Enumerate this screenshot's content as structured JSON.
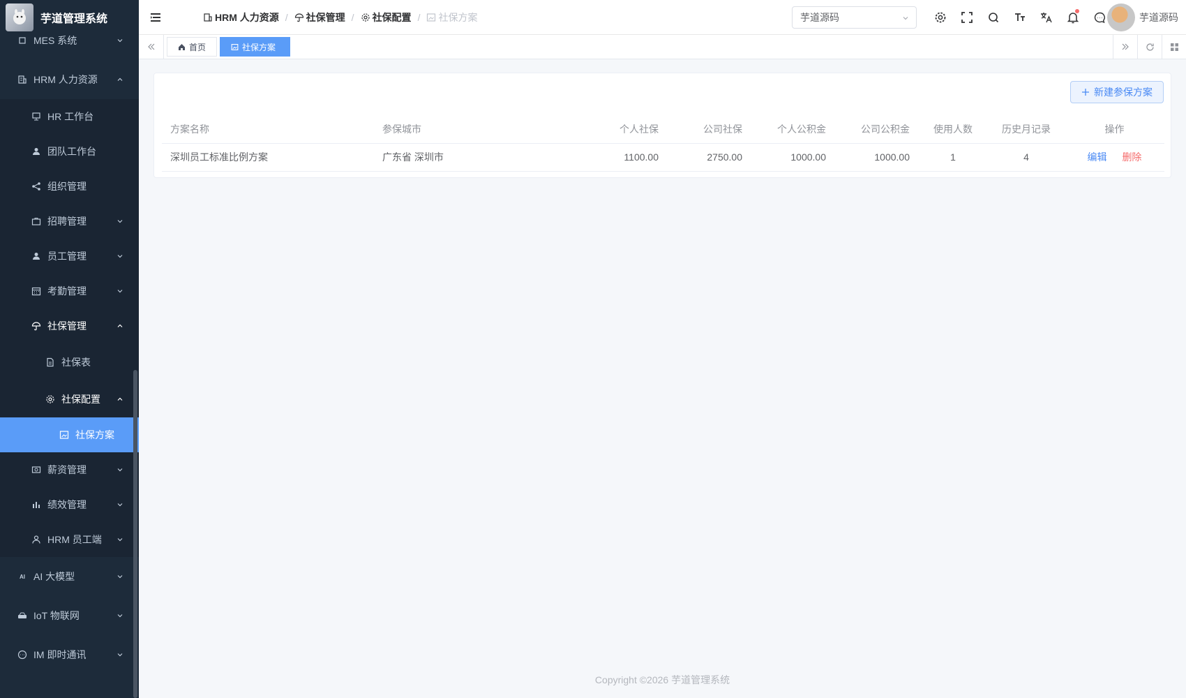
{
  "app": {
    "title": "芋道管理系统"
  },
  "sidebar": {
    "items": [
      {
        "label": "MES 系统",
        "level": 0
      },
      {
        "label": "HRM 人力资源",
        "level": 0
      },
      {
        "label": "HR 工作台",
        "level": 1
      },
      {
        "label": "团队工作台",
        "level": 1
      },
      {
        "label": "组织管理",
        "level": 1
      },
      {
        "label": "招聘管理",
        "level": 1
      },
      {
        "label": "员工管理",
        "level": 1
      },
      {
        "label": "考勤管理",
        "level": 1
      },
      {
        "label": "社保管理",
        "level": 1
      },
      {
        "label": "社保表",
        "level": 2
      },
      {
        "label": "社保配置",
        "level": 2
      },
      {
        "label": "社保方案",
        "level": 3
      },
      {
        "label": "薪资管理",
        "level": 1
      },
      {
        "label": "绩效管理",
        "level": 1
      },
      {
        "label": "HRM 员工端",
        "level": 1
      },
      {
        "label": "AI 大模型",
        "level": 0
      },
      {
        "label": "IoT 物联网",
        "level": 0
      },
      {
        "label": "IM 即时通讯",
        "level": 0
      }
    ]
  },
  "breadcrumb": [
    "HRM 人力资源",
    "社保管理",
    "社保配置",
    "社保方案"
  ],
  "header": {
    "tenant": "芋道源码",
    "username": "芋道源码"
  },
  "tags": {
    "home": "首页",
    "current": "社保方案"
  },
  "toolbar": {
    "new_label": "新建参保方案"
  },
  "table": {
    "headers": [
      "方案名称",
      "参保城市",
      "个人社保",
      "公司社保",
      "个人公积金",
      "公司公积金",
      "使用人数",
      "历史月记录",
      "操作"
    ],
    "rows": [
      {
        "name": "深圳员工标准比例方案",
        "city": "广东省 深圳市",
        "personal_social": "1100.00",
        "company_social": "2750.00",
        "personal_fund": "1000.00",
        "company_fund": "1000.00",
        "users": "1",
        "history": "4",
        "edit": "编辑",
        "delete": "删除"
      }
    ]
  },
  "footer": {
    "copyright": "Copyright ©2026 芋道管理系统"
  }
}
